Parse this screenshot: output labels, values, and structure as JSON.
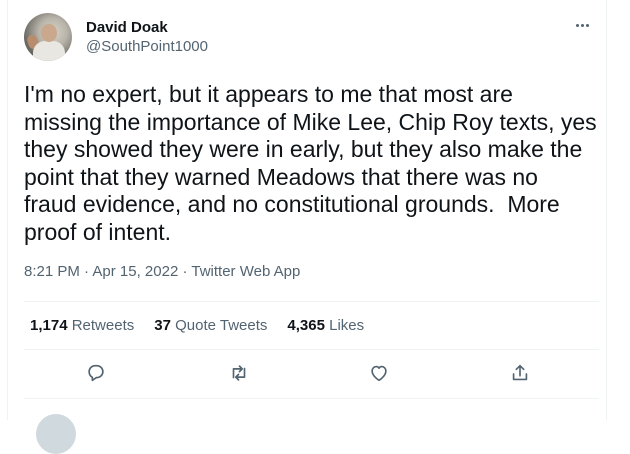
{
  "tweet": {
    "author_name": "David Doak",
    "author_handle": "@SouthPoint1000",
    "text": "I'm no expert, but it appears to me that most are\nmissing the importance of Mike Lee, Chip Roy texts, yes\nthey showed they were in early, but they also make the\npoint that they warned Meadows that there was no\nfraud evidence, and no constitutional grounds.  More\nproof of intent.",
    "time": "8:21 PM",
    "date": "Apr 15, 2022",
    "source": "Twitter Web App",
    "separator": "·"
  },
  "stats": {
    "retweets_count": "1,174",
    "retweets_label": "Retweets",
    "quotes_count": "37",
    "quotes_label": "Quote Tweets",
    "likes_count": "4,365",
    "likes_label": "Likes"
  },
  "icons": {
    "more": "more-horizontal-icon",
    "reply": "reply-icon",
    "retweet": "retweet-icon",
    "like": "like-icon",
    "share": "share-icon"
  },
  "colors": {
    "text_primary": "#0f1419",
    "text_secondary": "#536471",
    "divider": "#eff3f4"
  }
}
